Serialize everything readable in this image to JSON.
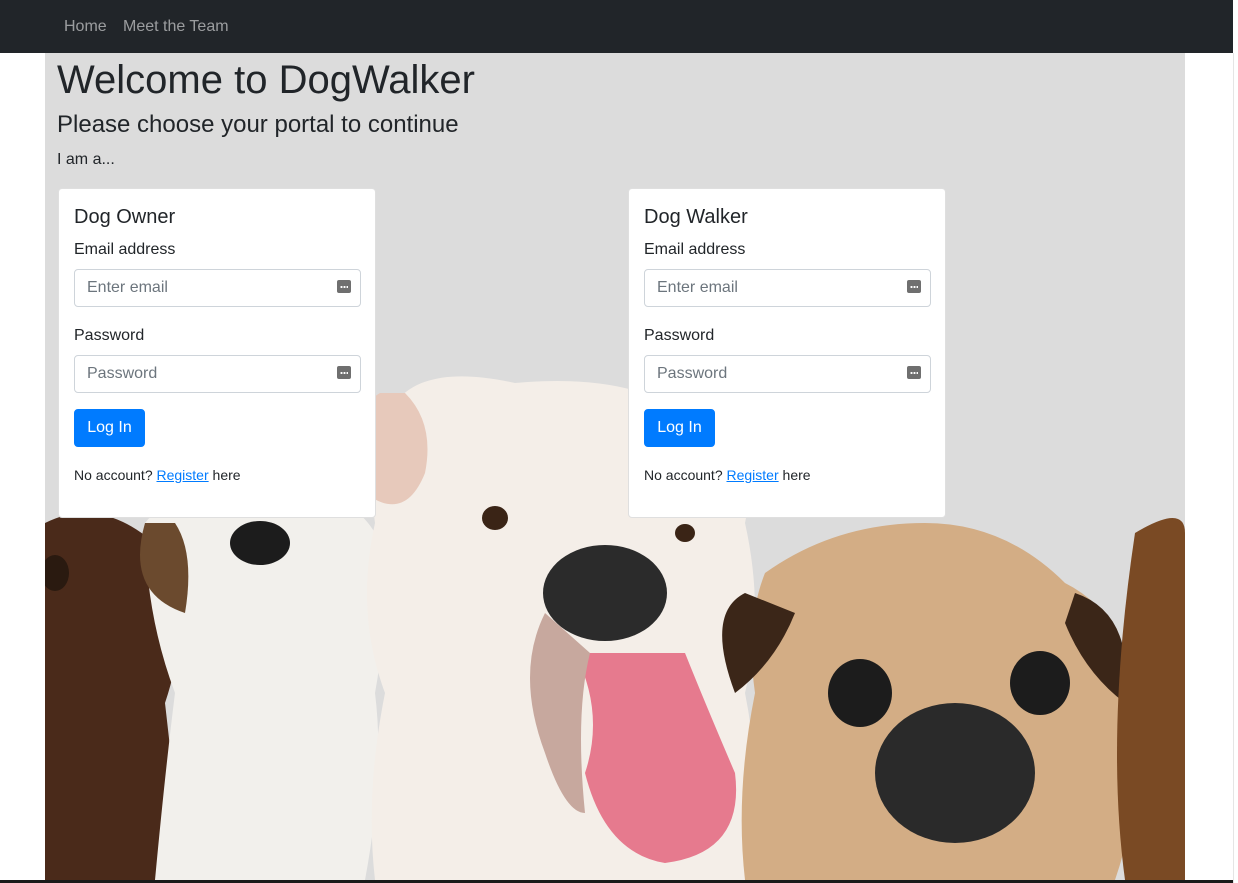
{
  "nav": {
    "items": [
      {
        "label": "Home"
      },
      {
        "label": "Meet the Team"
      }
    ]
  },
  "hero": {
    "title": "Welcome to DogWalker",
    "subtitle": "Please choose your portal to continue",
    "intro": "I am a..."
  },
  "portals": [
    {
      "title": "Dog Owner",
      "email_label": "Email address",
      "email_placeholder": "Enter email",
      "password_label": "Password",
      "password_placeholder": "Password",
      "login_label": "Log In",
      "register_prefix": "No account?",
      "register_link": "Register",
      "register_suffix": "here"
    },
    {
      "title": "Dog Walker",
      "email_label": "Email address",
      "email_placeholder": "Enter email",
      "password_label": "Password",
      "password_placeholder": "Password",
      "login_label": "Log In",
      "register_prefix": "No account?",
      "register_link": "Register",
      "register_suffix": "here"
    }
  ],
  "icons": {
    "field_icon": "password-manager-icon"
  },
  "colors": {
    "navbar": "#212529",
    "primary": "#007bff",
    "hero_background": "#dcdcdc"
  }
}
